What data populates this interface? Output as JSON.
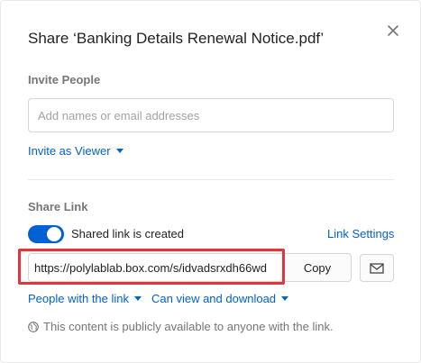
{
  "dialog": {
    "title": "Share ‘Banking Details Renewal Notice.pdf’",
    "close_icon": "close-icon"
  },
  "invite": {
    "section_label": "Invite People",
    "input_placeholder": "Add names or email addresses",
    "input_value": "",
    "permission_label": "Invite as Viewer"
  },
  "share_link": {
    "section_label": "Share Link",
    "toggle_on": true,
    "toggle_label": "Shared link is created",
    "settings_label": "Link Settings",
    "url": "https://polylablab.box.com/s/idvadsrxdh66wd",
    "copy_label": "Copy",
    "email_icon": "envelope-icon",
    "access_label": "People with the link",
    "permission_label": "Can view and download",
    "public_note": "This content is publicly available to anyone with the link.",
    "globe_icon": "globe-icon"
  },
  "colors": {
    "accent": "#0061d5",
    "highlight": "#e4353f",
    "muted": "#767676"
  }
}
